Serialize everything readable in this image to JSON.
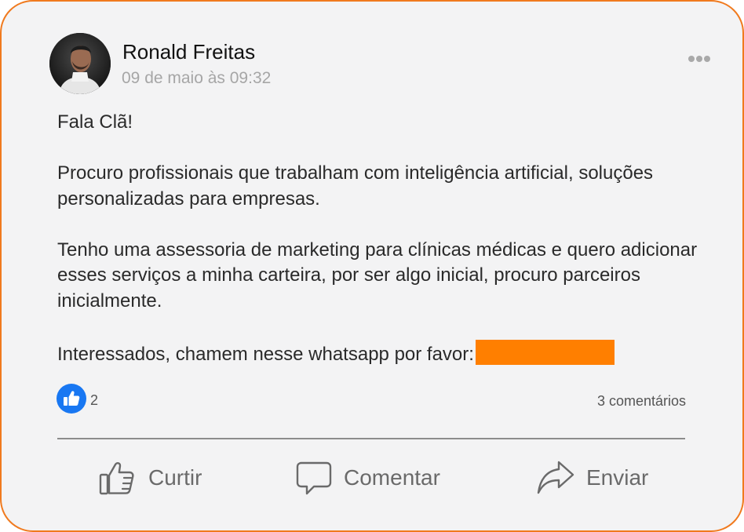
{
  "post": {
    "author": "Ronald Freitas",
    "timestamp": "09 de maio às 09:32",
    "paragraphs": [
      "Fala Clã!",
      "Procuro profissionais que trabalham com inteligência artificial, soluções personalizadas para empresas.",
      "Tenho uma assessoria de marketing para clínicas médicas e quero adicionar esses serviços a minha carteira, por ser algo inicial, procuro parceiros inicialmente.",
      "Interessados, chamem nesse whatsapp por favor:"
    ],
    "redaction_color": "#ff7f00"
  },
  "reactions": {
    "like_count": "2",
    "comments_label": "3 comentários"
  },
  "actions": {
    "like_label": "Curtir",
    "comment_label": "Comentar",
    "share_label": "Enviar"
  },
  "icons": {
    "more": "more-horizontal-icon",
    "like_badge": "thumbs-up-badge-icon",
    "like": "thumbs-up-outline-icon",
    "comment": "speech-bubble-icon",
    "share": "share-arrow-icon"
  },
  "colors": {
    "accent_border": "#f07a1e",
    "like_blue": "#1877f2",
    "card_background": "#f3f3f4"
  }
}
